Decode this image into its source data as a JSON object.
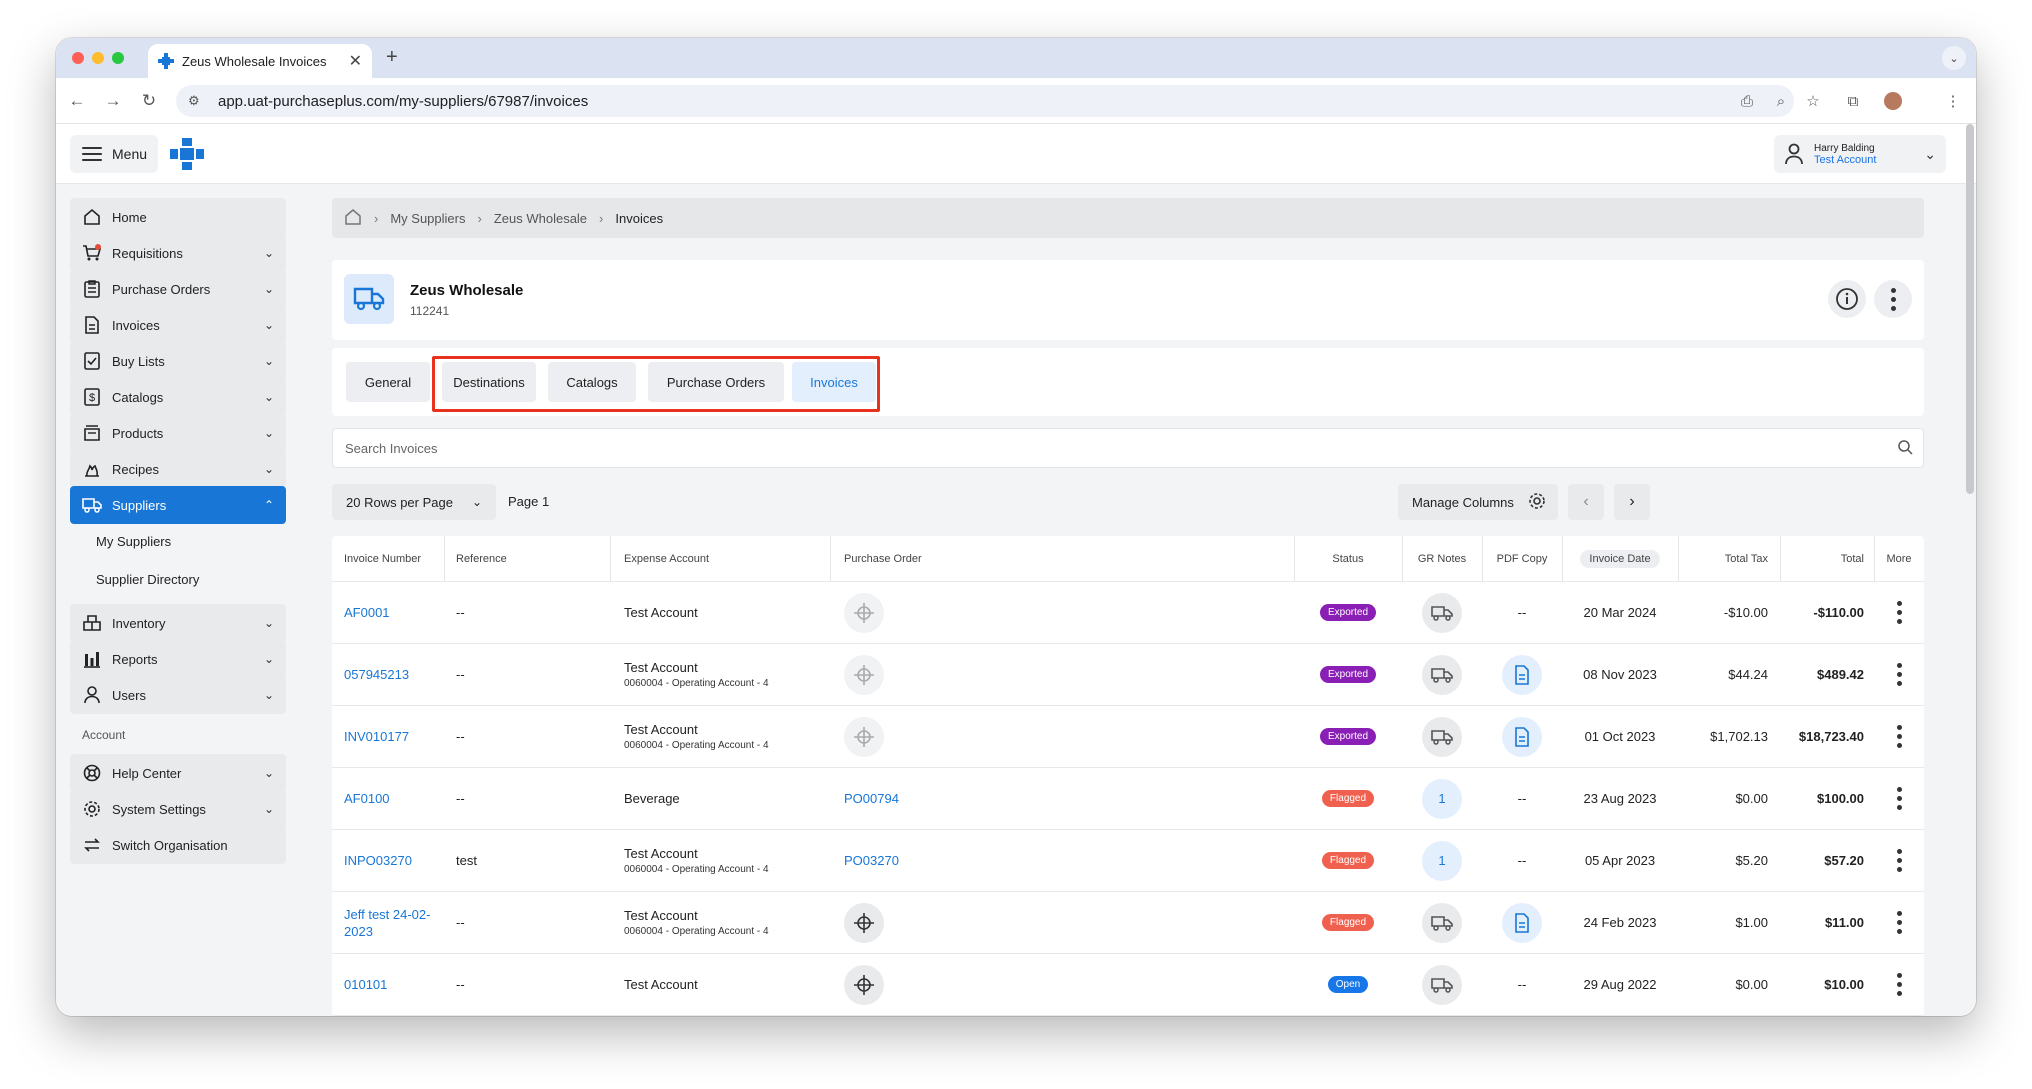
{
  "browser": {
    "tab_title": "Zeus Wholesale Invoices",
    "url": "app.uat-purchaseplus.com/my-suppliers/67987/invoices",
    "new_tab": "+",
    "close": "✕"
  },
  "topbar": {
    "menu_label": "Menu",
    "user_name": "Harry Balding",
    "user_account": "Test Account"
  },
  "sidebar": {
    "items": [
      {
        "label": "Home",
        "icon": "home-icon"
      },
      {
        "label": "Requisitions",
        "icon": "cart-icon"
      },
      {
        "label": "Purchase Orders",
        "icon": "clipboard-icon"
      },
      {
        "label": "Invoices",
        "icon": "document-icon"
      },
      {
        "label": "Buy Lists",
        "icon": "checklist-icon"
      },
      {
        "label": "Catalogs",
        "icon": "dollar-file-icon"
      },
      {
        "label": "Products",
        "icon": "box-icon"
      },
      {
        "label": "Recipes",
        "icon": "flame-icon"
      },
      {
        "label": "Suppliers",
        "icon": "truck-icon"
      },
      {
        "label": "Inventory",
        "icon": "inventory-icon"
      },
      {
        "label": "Reports",
        "icon": "bar-chart-icon"
      },
      {
        "label": "Users",
        "icon": "user-icon"
      }
    ],
    "sub_items": [
      "My Suppliers",
      "Supplier Directory"
    ],
    "section_label": "Account",
    "account_items": [
      {
        "label": "Help Center"
      },
      {
        "label": "System Settings"
      },
      {
        "label": "Switch Organisation"
      }
    ]
  },
  "breadcrumb": [
    "My Suppliers",
    "Zeus Wholesale",
    "Invoices"
  ],
  "supplier": {
    "name": "Zeus Wholesale",
    "id": "112241"
  },
  "tabs": [
    "General",
    "Destinations",
    "Catalogs",
    "Purchase Orders",
    "Invoices"
  ],
  "search": {
    "placeholder": "Search Invoices"
  },
  "controls": {
    "rows_per_page": "20 Rows per Page",
    "page": "Page 1",
    "manage_columns": "Manage Columns"
  },
  "table": {
    "columns": [
      "Invoice Number",
      "Reference",
      "Expense Account",
      "Purchase Order",
      "Status",
      "GR Notes",
      "PDF Copy",
      "Invoice Date",
      "Total Tax",
      "Total",
      "More"
    ],
    "rows": [
      {
        "invoice": "AF0001",
        "reference": "--",
        "account": "Test Account",
        "account_sub": "",
        "po": "",
        "status": "Exported",
        "gr": "truck",
        "pdf": "--",
        "date": "20 Mar 2024",
        "tax": "-$10.00",
        "total": "-$110.00"
      },
      {
        "invoice": "057945213",
        "reference": "--",
        "account": "Test Account",
        "account_sub": "0060004 - Operating Account - 4",
        "po": "",
        "status": "Exported",
        "gr": "truck",
        "pdf": "doc",
        "date": "08 Nov 2023",
        "tax": "$44.24",
        "total": "$489.42"
      },
      {
        "invoice": "INV010177",
        "reference": "--",
        "account": "Test Account",
        "account_sub": "0060004 - Operating Account - 4",
        "po": "",
        "status": "Exported",
        "gr": "truck",
        "pdf": "doc",
        "date": "01 Oct 2023",
        "tax": "$1,702.13",
        "total": "$18,723.40"
      },
      {
        "invoice": "AF0100",
        "reference": "--",
        "account": "Beverage",
        "account_sub": "",
        "po": "PO00794",
        "status": "Flagged",
        "gr": "1",
        "pdf": "--",
        "date": "23 Aug 2023",
        "tax": "$0.00",
        "total": "$100.00"
      },
      {
        "invoice": "INPO03270",
        "reference": "test",
        "account": "Test Account",
        "account_sub": "0060004 - Operating Account - 4",
        "po": "PO03270",
        "status": "Flagged",
        "gr": "1",
        "pdf": "--",
        "date": "05 Apr 2023",
        "tax": "$5.20",
        "total": "$57.20"
      },
      {
        "invoice": "Jeff test 24-02-2023",
        "reference": "--",
        "account": "Test Account",
        "account_sub": "0060004 - Operating Account - 4",
        "po": "",
        "status": "Flagged",
        "gr": "truck",
        "pdf": "doc",
        "date": "24 Feb 2023",
        "tax": "$1.00",
        "total": "$11.00"
      },
      {
        "invoice": "010101",
        "reference": "--",
        "account": "Test Account",
        "account_sub": "",
        "po": "",
        "status": "Open",
        "gr": "truck",
        "pdf": "--",
        "date": "29 Aug 2022",
        "tax": "$0.00",
        "total": "$10.00"
      }
    ]
  },
  "colors": {
    "accent": "#1877d6",
    "exported": "#8a1fb5",
    "flagged": "#f0604e",
    "open": "#1877e8",
    "highlight": "#e8321f"
  }
}
